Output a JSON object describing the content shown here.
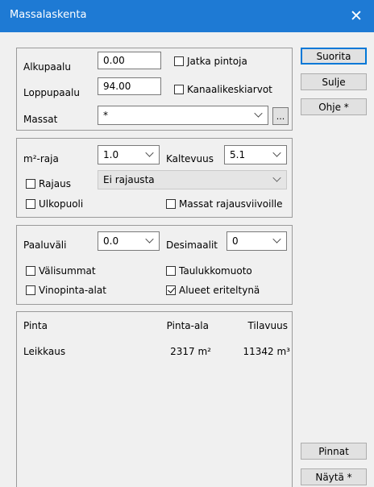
{
  "window": {
    "title": "Massalaskenta"
  },
  "group1": {
    "alkupaalu_label": "Alkupaalu",
    "alkupaalu_value": "0.00",
    "loppupaalu_label": "Loppupaalu",
    "loppupaalu_value": "94.00",
    "massat_label": "Massat",
    "massat_value": "*",
    "browse_label": "...",
    "jatka_pintoja": "Jatka pintoja",
    "kanaalikeskiarvot": "Kanaalikeskiarvot"
  },
  "group2": {
    "m2raja_label": "m²-raja",
    "m2raja_value": "1.0",
    "kaltevuus_label": "Kaltevuus",
    "kaltevuus_value": "5.1",
    "rajaus": "Rajaus",
    "rajaus_value": "Ei rajausta",
    "ulkopuoli": "Ulkopuoli",
    "massat_rajaus": "Massat rajausviivoille"
  },
  "group3": {
    "paaluvali_label": "Paaluväli",
    "paaluvali_value": "0.0",
    "desimaalit_label": "Desimaalit",
    "desimaalit_value": "0",
    "valisummat": "Välisummat",
    "taulukkomuoto": "Taulukkomuoto",
    "vinopinta": "Vinopinta-alat",
    "alueet": "Alueet eriteltynä"
  },
  "results": {
    "headers": {
      "pinta": "Pinta",
      "pinta_ala": "Pinta-ala",
      "tilavuus": "Tilavuus"
    },
    "rows": [
      {
        "pinta": "Leikkaus",
        "pinta_ala": "2317 m²",
        "tilavuus": "11342 m³"
      }
    ]
  },
  "buttons": {
    "suorita": "Suorita",
    "sulje": "Sulje",
    "ohje": "Ohje *",
    "pinnat": "Pinnat",
    "nayta": "Näytä *"
  },
  "colors": {
    "titlebar": "#1e7ad4",
    "default_button_border": "#0078d7"
  },
  "icons": {
    "close": "close-icon",
    "dropdown": "chevron-down-icon"
  }
}
